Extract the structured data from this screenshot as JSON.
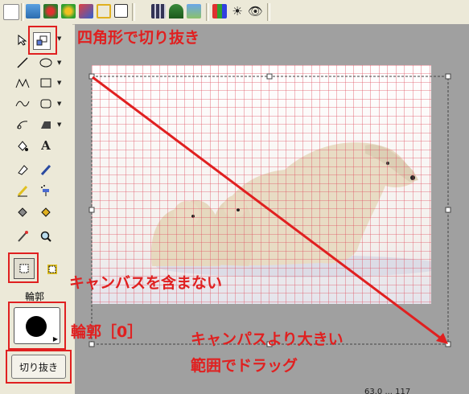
{
  "annotations": {
    "rect_crop": "四角形で切り抜き",
    "exclude_canvas": "キャンバスを含まない",
    "border_zero": "輪郭［0］",
    "drag_larger_1": "キャンパスより大きい",
    "drag_larger_2": "範囲でドラッグ"
  },
  "toolbox": {
    "outline_label": "輪郭",
    "text_tool_glyph": "A",
    "crop_button_label": "切り抜き"
  },
  "status": {
    "partial_text": "63.0 ... 117"
  },
  "colors": {
    "annotation": "#e02020",
    "grid": "#e05060",
    "canvas_bg": "#a0a0a0"
  }
}
